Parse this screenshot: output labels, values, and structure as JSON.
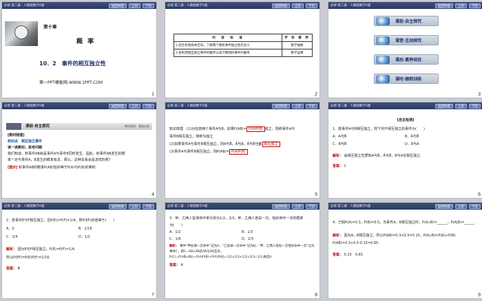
{
  "header": {
    "book": "必修 第二册 · 人教版数学A版",
    "nav_label": "返回导航",
    "prev_label": "上页",
    "next_label": "下页"
  },
  "slides": [
    {
      "number": "1",
      "chapter": "第十章",
      "title": "概 率",
      "subtitle": "10．2　事件的相互独立性",
      "footer": "第一PPT模板网-WWW.1PPT.COM"
    },
    {
      "number": "2",
      "table_headers": [
        "内　容　标　准",
        "学 科 素 养"
      ],
      "rows": [
        [
          "1.结合有限样本空间，了解两个随机事件独立性的含义.",
          "数学抽象"
        ],
        [
          "2.会利用相互独立事件的概率公式计算随机事件的概率.",
          "数学运算"
        ]
      ]
    },
    {
      "number": "3",
      "menu": [
        "课前·自主探究",
        "课堂·互动探究",
        "课后·素养培优",
        "课时·跟踪训练"
      ]
    },
    {
      "number": "4",
      "section": "课前·自主探究",
      "section_right": "教材梳理　基础自测",
      "lines": [
        "[教材梳理]",
        "知识点　相互独立事件",
        "读一读教材，思考问题",
        "我们知道，积事件AB就是事件A与事件B同时发生．因此，积事件AB发生的概",
        "率一定与事件A，B发生的概率有关．那么，这种关系会是怎样的呢？"
      ],
      "hint_label": "[提示]",
      "hint_text": "积事件AB的概率P(AB)恰好等于P(A)与P(B)的乘积."
    },
    {
      "number": "5",
      "line1_pre": "知识梳理　(1)对任意两个事件A与B，如果P(AB)=",
      "line1_box": "P(A)P(B)",
      "line1_post": "成立，则称事件A与",
      "line2": "事件B相互独立，简称为独立.",
      "line3_pre": "(2)如果事件A与事件B相互独立，则A与B̄，Ā与B，Ā与B̄也都",
      "line3_box": "相互独立",
      "line4_pre": "(3)事件A与事件B相互独立，则P(AB)=",
      "line4_box": "P(A)P(B)"
    },
    {
      "number": "6",
      "title": "[自主检测]",
      "question": "1．若事件A与B相互独立，则下列不相互独立的事件为(　　)",
      "options": [
        "A．A与B̄",
        "B．Ā与B̄",
        "C．B与B̄",
        "D．B与A"
      ],
      "analysis_label": "解析：",
      "analysis": "由相互独立性质知A与B̄，Ā与B̄，B与A也相互独立.",
      "answer_label": "答案：",
      "answer": "C"
    },
    {
      "number": "7",
      "question": "2．若事件E与F相互独立，且P(E)=P(F)=1/4，则P(EF)的值等于(　　)",
      "options": [
        "A．0",
        "B．1/16",
        "C．1/4",
        "D．1/2"
      ],
      "analysis_label": "解析：",
      "analysis1": "因为E与F相互独立，P(E)=P(F)=1/4.",
      "analysis2": "所以P(EF)=P(E)P(F)=1/16.",
      "answer_label": "答案：",
      "answer": "B"
    },
    {
      "number": "8",
      "question": "3．甲、乙两人投球命中率分别为1/2，2/3，甲、乙两人各投一次，恰好命中一次的概率",
      "question2": "为(　　)",
      "options": [
        "A．1/2",
        "B．1/3",
        "C．1/6",
        "D．2/3"
      ],
      "analysis_label": "解析：",
      "analysis": "事件“甲投球一次命中”记为A，“乙投球一次命中”记为B，“甲、乙两人各投一次恰好命中一次”记为事件C，则C=AB̄∪ĀB且AB̄与ĀB互斥，P(C)=P(AB̄∪ĀB)=P(A)P(B̄)+P(Ā)P(B)=1/2×1/3+1/2×2/3=1/2.故选A.",
      "answer_label": "答案：",
      "answer": "A"
    },
    {
      "number": "9",
      "question": "4．已知P(A)=0.3，P(B)=0.5，当事件A，B相互独立时，P(A∪B)=______，P(A|B)=______.",
      "analysis_label": "解析：",
      "analysis": "因为A，B相互独立，所以P(AB)=0.3×0.5=0.15，P(A∪B)=P(A)+P(B)-P(AB)=0.3+0.5-0.15=0.65.",
      "answer_label": "答案：",
      "answer": "0.15　0.65"
    }
  ]
}
